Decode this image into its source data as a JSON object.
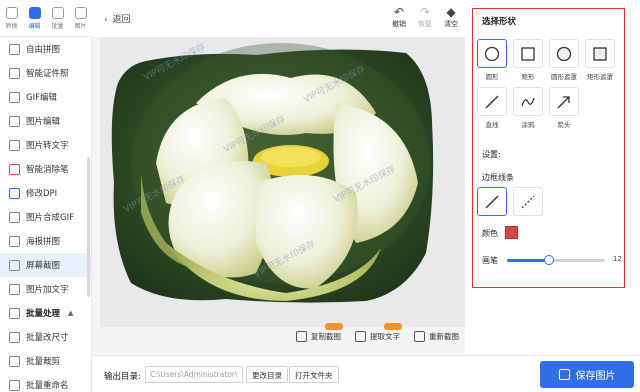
{
  "topnav": {
    "tabs": [
      {
        "label": "转换",
        "icon": "convert-icon"
      },
      {
        "label": "编辑",
        "icon": "edit-icon"
      },
      {
        "label": "批量",
        "icon": "batch-icon"
      },
      {
        "label": "图片",
        "icon": "image-icon"
      }
    ]
  },
  "sidebar": {
    "items": [
      {
        "label": "自由拼图",
        "icon": "collage-icon"
      },
      {
        "label": "智能证件照",
        "icon": "id-photo-icon"
      },
      {
        "label": "GIF编辑",
        "icon": "gif-icon"
      },
      {
        "label": "图片编辑",
        "icon": "image-edit-icon"
      },
      {
        "label": "图片转文字",
        "icon": "ocr-icon"
      },
      {
        "label": "智能消除笔",
        "icon": "eraser-pen-icon"
      },
      {
        "label": "修改DPI",
        "icon": "dpi-icon"
      },
      {
        "label": "图片合成GIF",
        "icon": "gif-compose-icon"
      },
      {
        "label": "海报拼图",
        "icon": "poster-icon"
      },
      {
        "label": "屏幕截图",
        "icon": "screenshot-icon"
      },
      {
        "label": "图片加文字",
        "icon": "add-text-icon"
      },
      {
        "label": "批量处理",
        "icon": "batch-group-icon"
      },
      {
        "label": "批量改尺寸",
        "icon": "resize-icon"
      },
      {
        "label": "批量裁剪",
        "icon": "crop-icon"
      },
      {
        "label": "批量重命名",
        "icon": "rename-icon"
      }
    ],
    "active_index": 9
  },
  "toolbar": {
    "back": "返回",
    "undo": "撤销",
    "redo": "恢复",
    "clear": "清空"
  },
  "canvas": {
    "watermark": "VIP可无水印保存",
    "actions": {
      "copy": "复制截图",
      "extract_text": "提取文字",
      "recapture": "重新截图"
    }
  },
  "panel": {
    "title": "选择形状",
    "shapes": [
      {
        "label": "圆形",
        "icon": "circle-icon",
        "selected": true
      },
      {
        "label": "矩形",
        "icon": "rectangle-icon",
        "selected": false
      },
      {
        "label": "圆形遮罩",
        "icon": "circle-mask-icon",
        "selected": false
      },
      {
        "label": "矩形遮罩",
        "icon": "rectangle-mask-icon",
        "selected": false
      },
      {
        "label": "直线",
        "icon": "line-icon",
        "selected": false
      },
      {
        "label": "涂鸦",
        "icon": "doodle-icon",
        "selected": false
      },
      {
        "label": "箭头",
        "icon": "arrow-icon",
        "selected": false
      }
    ],
    "settings_title": "设置:",
    "border_label": "边框线条",
    "border_styles": [
      {
        "name": "solid",
        "selected": true
      },
      {
        "name": "dashed",
        "selected": false
      }
    ],
    "color_label": "颜色",
    "color_value": "#d6454a",
    "brush_label": "画笔",
    "brush_value": 12,
    "brush_display": "12",
    "brush_fraction": 0.43
  },
  "bottom": {
    "output_label": "输出目录:",
    "output_path": "C:\\Users\\Administrator\\",
    "change_dir": "更改目录",
    "open_folder": "打开文件夹",
    "save": "保存图片"
  },
  "colors": {
    "accent": "#2f6fe3",
    "highlight_border": "#e0312f",
    "badge": "#f5922b"
  }
}
